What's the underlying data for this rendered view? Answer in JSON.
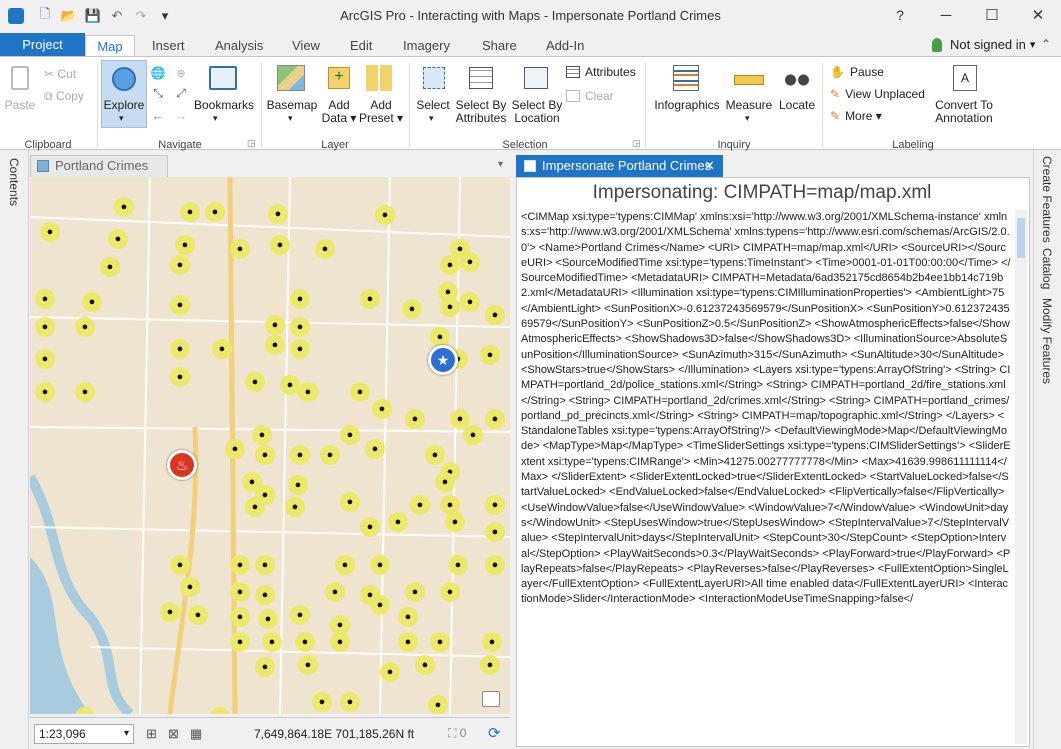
{
  "window": {
    "title": "ArcGIS Pro - Interacting with Maps - Impersonate Portland Crimes",
    "help": "?",
    "minimize": "─",
    "maximize": "☐",
    "close": "✕"
  },
  "qat": {
    "new": "🗋",
    "open": "📂",
    "save": "💾",
    "undo": "↶",
    "redo": "↷",
    "customize": "▾"
  },
  "tabs": {
    "project": "Project",
    "map": "Map",
    "insert": "Insert",
    "analysis": "Analysis",
    "view": "View",
    "edit": "Edit",
    "imagery": "Imagery",
    "share": "Share",
    "addin": "Add-In"
  },
  "account": {
    "status": "Not signed in",
    "caret": "▾",
    "collapse": "⌃"
  },
  "ribbon": {
    "clipboard": {
      "group": "Clipboard",
      "paste": "Paste",
      "cut": "Cut",
      "copy": "Copy"
    },
    "navigate": {
      "group": "Navigate",
      "explore": "Explore",
      "bookmarks": "Bookmarks"
    },
    "layer": {
      "group": "Layer",
      "basemap": "Basemap",
      "add_data": "Add\nData ▾",
      "add_preset": "Add\nPreset ▾"
    },
    "selection": {
      "group": "Selection",
      "select": "Select",
      "select_by_attributes": "Select By\nAttributes",
      "select_by_location": "Select By\nLocation",
      "attributes": "Attributes",
      "clear": "Clear"
    },
    "inquiry": {
      "group": "Inquiry",
      "infographics": "Infographics",
      "measure": "Measure",
      "locate": "Locate"
    },
    "labeling": {
      "group": "Labeling",
      "pause": "Pause",
      "view_unplaced": "View Unplaced",
      "more": "More ▾",
      "convert": "Convert To\nAnnotation"
    }
  },
  "left_dock": {
    "contents": "Contents"
  },
  "right_dock": {
    "create_features": "Create Features",
    "catalog": "Catalog",
    "modify_features": "Modify Features"
  },
  "map_view": {
    "tab_label": "Portland Crimes",
    "scale": "1:23,096",
    "coords": "7,649,864.18E 701,185.26N ft",
    "selected_count": "0",
    "dropdown": "▾"
  },
  "pane": {
    "tab_label": "Impersonate Portland Crimes",
    "close": "✕",
    "heading": "Impersonating:  CIMPATH=map/map.xml",
    "xml": "<CIMMap xsi:type='typens:CIMMap' xmlns:xsi='http://www.w3.org/2001/XMLSchema-instance' xmlns:xs='http://www.w3.org/2001/XMLSchema' xmlns:typens='http://www.esri.com/schemas/ArcGIS/2.0.0'> <Name>Portland Crimes</Name> <URI> CIMPATH=map/map.xml</URI> <SourceURI></SourceURI> <SourceModifiedTime xsi:type='typens:TimeInstant'> <Time>0001-01-01T00:00:00</Time> </SourceModifiedTime> <MetadataURI> CIMPATH=Metadata/6ad352175cd8654b2b4ee1bb14c719b2.xml</MetadataURI> <Illumination xsi:type='typens:CIMIlluminationProperties'> <AmbientLight>75</AmbientLight> <SunPositionX>-0.61237243569579</SunPositionX> <SunPositionY>0.61237243569579</SunPositionY> <SunPositionZ>0.5</SunPositionZ> <ShowAtmosphericEffects>false</ShowAtmosphericEffects> <ShowShadows3D>false</ShowShadows3D> <IlluminationSource>AbsoluteSunPosition</IlluminationSource> <SunAzimuth>315</SunAzimuth> <SunAltitude>30</SunAltitude> <ShowStars>true</ShowStars> </Illumination> <Layers xsi:type='typens:ArrayOfString'> <String> CIMPATH=portland_2d/police_stations.xml</String> <String> CIMPATH=portland_2d/fire_stations.xml</String> <String> CIMPATH=portland_2d/crimes.xml</String> <String> CIMPATH=portland_crimes/portland_pd_precincts.xml</String> <String> CIMPATH=map/topographic.xml</String> </Layers> <StandaloneTables xsi:type='typens:ArrayOfString'/> <DefaultViewingMode>Map</DefaultViewingMode> <MapType>Map</MapType> <TimeSliderSettings xsi:type='typens:CIMSliderSettings'> <SliderExtent xsi:type='typens:CIMRange'> <Min>41275.00277777778</Min> <Max>41639.998611111114</Max> </SliderExtent> <SliderExtentLocked>true</SliderExtentLocked> <StartValueLocked>false</StartValueLocked> <EndValueLocked>false</EndValueLocked> <FlipVertically>false</FlipVertically> <UseWindowValue>false</UseWindowValue> <WindowValue>7</WindowValue> <WindowUnit>days</WindowUnit> <StepUsesWindow>true</StepUsesWindow> <StepIntervalValue>7</StepIntervalValue> <StepIntervalUnit>days</StepIntervalUnit> <StepCount>30</StepCount> <StepOption>Interval</StepOption> <PlayWaitSeconds>0.3</PlayWaitSeconds> <PlayForward>true</PlayForward> <PlayRepeats>false</PlayRepeats> <PlayReverses>false</PlayReverses> <FullExtentOption>SingleLayer</FullExtentOption> <FullExtentLayerURI>All time enabled data</FullExtentLayerURI> <InteractionMode>Slider</InteractionMode> <InteractionModeUseTimeSnapping>false</"
  },
  "colors": {
    "accent": "#1e74c7",
    "poi": "#ece96a",
    "map_bg": "#eee4cf",
    "river": "#a9cbe0",
    "police": "#2f6fd1",
    "fire": "#d9361f"
  }
}
